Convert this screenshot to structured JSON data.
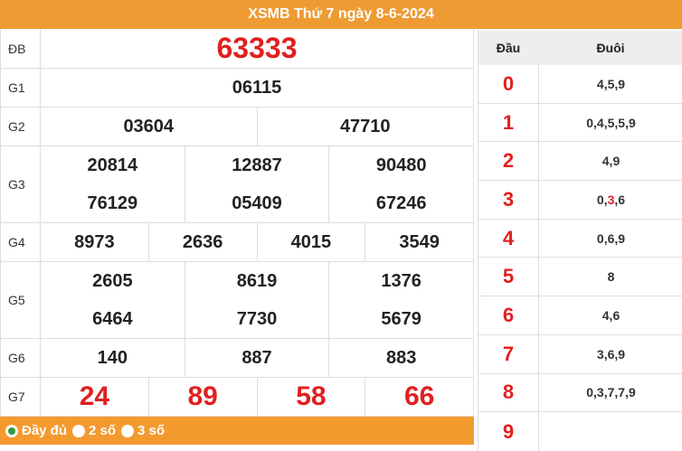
{
  "title": "XSMB Thứ 7 ngày 8-6-2024",
  "prizes": {
    "db": {
      "label": "ĐB",
      "values": [
        "63333"
      ]
    },
    "g1": {
      "label": "G1",
      "values": [
        "06115"
      ]
    },
    "g2": {
      "label": "G2",
      "values": [
        "03604",
        "47710"
      ]
    },
    "g3": {
      "label": "G3",
      "values": [
        "20814",
        "12887",
        "90480",
        "76129",
        "05409",
        "67246"
      ]
    },
    "g4": {
      "label": "G4",
      "values": [
        "8973",
        "2636",
        "4015",
        "3549"
      ]
    },
    "g5": {
      "label": "G5",
      "values": [
        "2605",
        "8619",
        "1376",
        "6464",
        "7730",
        "5679"
      ]
    },
    "g6": {
      "label": "G6",
      "values": [
        "140",
        "887",
        "883"
      ]
    },
    "g7": {
      "label": "G7",
      "values": [
        "24",
        "89",
        "58",
        "66"
      ]
    }
  },
  "options": [
    "Đầy đủ",
    "2 số",
    "3 số"
  ],
  "loto": {
    "head_dau": "Đầu",
    "head_duoi": "Đuôi",
    "rows": [
      {
        "dau": "0",
        "duoi": "4,5,9"
      },
      {
        "dau": "1",
        "duoi": "0,4,5,5,9"
      },
      {
        "dau": "2",
        "duoi": "4,9"
      },
      {
        "dau": "3",
        "duoi_pre": "0,",
        "duoi_hl": "3",
        "duoi_post": ",6"
      },
      {
        "dau": "4",
        "duoi": "0,6,9"
      },
      {
        "dau": "5",
        "duoi": "8"
      },
      {
        "dau": "6",
        "duoi": "4,6"
      },
      {
        "dau": "7",
        "duoi": "3,6,9"
      },
      {
        "dau": "8",
        "duoi": "0,3,7,7,9"
      },
      {
        "dau": "9",
        "duoi": ""
      }
    ]
  },
  "colors": {
    "header": "#ee9b33",
    "accent_red": "#e02020",
    "radio_on": "#2e9e3e"
  }
}
